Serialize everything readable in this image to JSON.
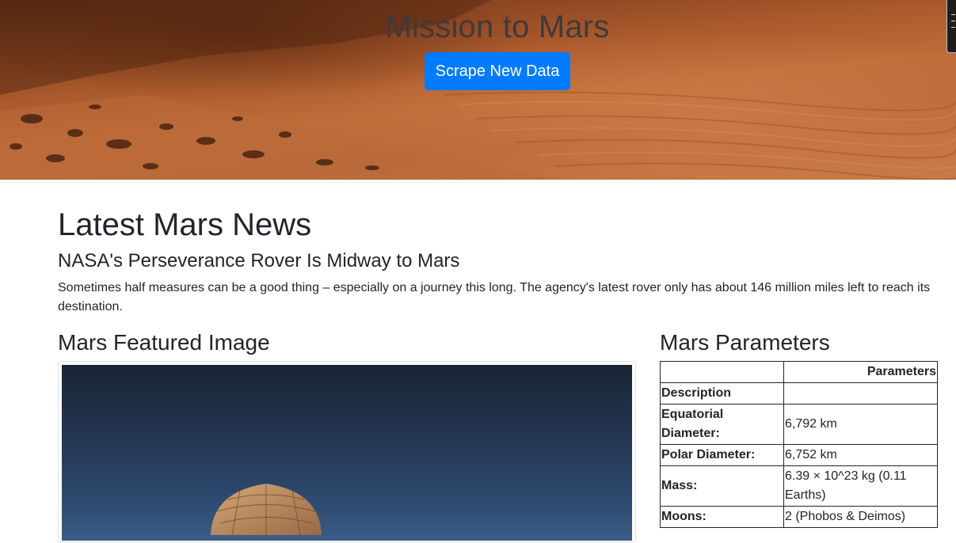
{
  "header": {
    "title": "Mission to Mars",
    "scrape_button": "Scrape New Data"
  },
  "news": {
    "section_heading": "Latest Mars News",
    "title": "NASA's Perseverance Rover Is Midway to Mars",
    "body": "Sometimes half measures can be a good thing – especially on a journey this long. The agency's latest rover only has about 146 million miles left to reach its destination."
  },
  "featured": {
    "heading": "Mars Featured Image"
  },
  "facts": {
    "heading": "Mars Parameters",
    "column_header": "Parameters",
    "rows": [
      {
        "label": "Description",
        "value": ""
      },
      {
        "label": "Equatorial Diameter:",
        "value": "6,792 km"
      },
      {
        "label": "Polar Diameter:",
        "value": "6,752 km"
      },
      {
        "label": "Mass:",
        "value": "6.39 × 10^23 kg (0.11 Earths)"
      },
      {
        "label": "Moons:",
        "value": "2 (Phobos & Deimos)"
      }
    ]
  },
  "colors": {
    "primary_button": "#007bff",
    "text": "#212529",
    "hero_title": "#3f3a3a"
  }
}
